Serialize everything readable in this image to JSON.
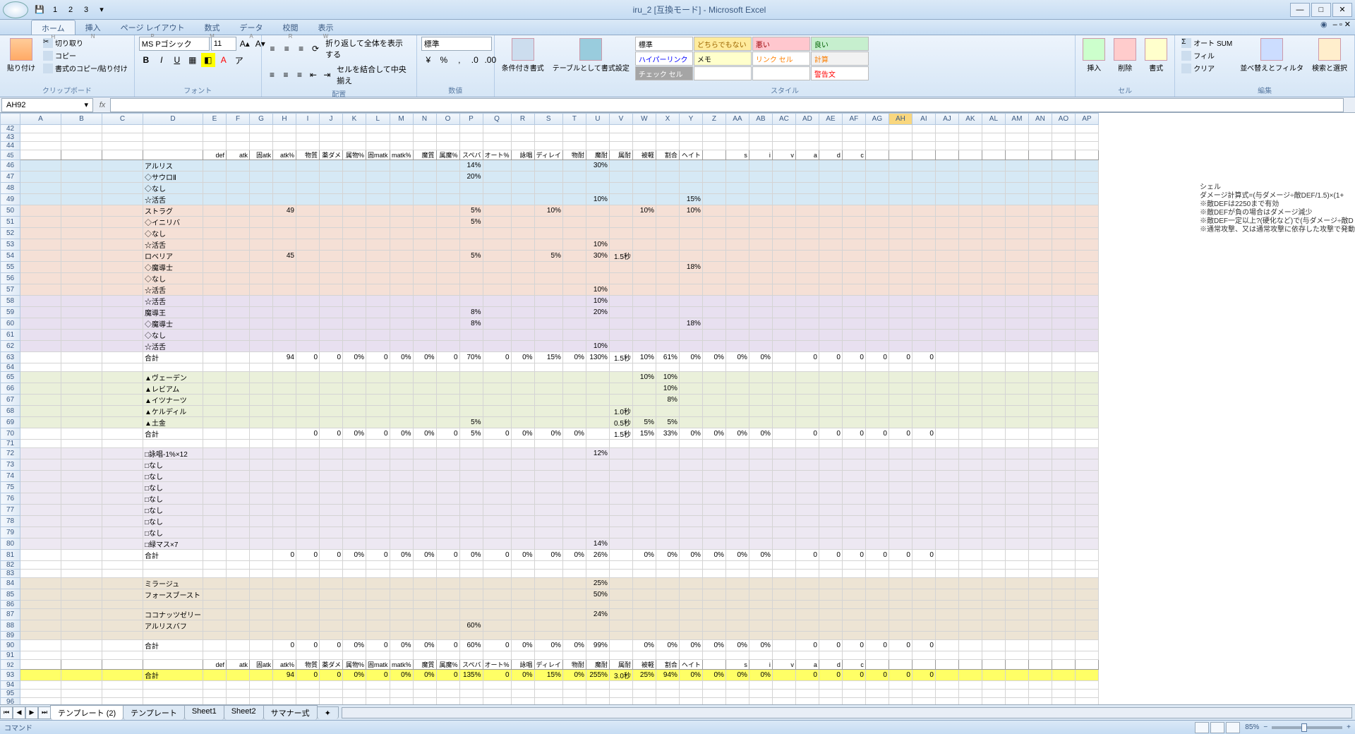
{
  "title": "iru_2 [互換モード] - Microsoft Excel",
  "tabs": [
    "ホーム",
    "挿入",
    "ページ レイアウト",
    "数式",
    "データ",
    "校閲",
    "表示"
  ],
  "tab_keys": [
    "H",
    "N",
    "P",
    "M",
    "A",
    "R",
    "W"
  ],
  "clipboard": {
    "paste": "貼り付け",
    "cut": "切り取り",
    "copy": "コピー",
    "fmt": "書式のコピー/貼り付け",
    "label": "クリップボード"
  },
  "font": {
    "name": "MS Pゴシック",
    "size": "11",
    "label": "フォント"
  },
  "align": {
    "wrap": "折り返して全体を表示する",
    "merge": "セルを結合して中央揃え",
    "label": "配置"
  },
  "number": {
    "fmt": "標準",
    "label": "数値"
  },
  "styles": {
    "cond": "条件付き書式",
    "tbl": "テーブルとして書式設定",
    "label": "スタイル",
    "cells": [
      {
        "t": "標準",
        "bg": "#fff",
        "c": "#000"
      },
      {
        "t": "どちらでもない",
        "bg": "#ffeb9c",
        "c": "#9c6500"
      },
      {
        "t": "悪い",
        "bg": "#ffc7ce",
        "c": "#9c0006"
      },
      {
        "t": "良い",
        "bg": "#c6efce",
        "c": "#006100"
      },
      {
        "t": "ハイパーリンク",
        "bg": "#fff",
        "c": "#0000ff"
      },
      {
        "t": "メモ",
        "bg": "#ffffcc",
        "c": "#000"
      },
      {
        "t": "リンク セル",
        "bg": "#fff",
        "c": "#ff8001"
      },
      {
        "t": "計算",
        "bg": "#f2f2f2",
        "c": "#fa7d00"
      },
      {
        "t": "チェック セル",
        "bg": "#a5a5a5",
        "c": "#fff"
      },
      {
        "t": "",
        "bg": "#fff",
        "c": "#000"
      },
      {
        "t": "",
        "bg": "#fff",
        "c": "#000"
      },
      {
        "t": "警告文",
        "bg": "#fff",
        "c": "#ff0000"
      }
    ]
  },
  "cells_grp": {
    "insert": "挿入",
    "delete": "削除",
    "format": "書式",
    "label": "セル"
  },
  "edit_grp": {
    "sum": "オート SUM",
    "fill": "フィル",
    "clear": "クリア",
    "sort": "並べ替えとフィルタ",
    "find": "検索と選択",
    "label": "編集"
  },
  "namebox": "AH92",
  "formula": "",
  "cols": [
    "A",
    "B",
    "C",
    "D",
    "E",
    "F",
    "G",
    "H",
    "I",
    "J",
    "K",
    "L",
    "M",
    "N",
    "O",
    "P",
    "Q",
    "R",
    "S",
    "T",
    "U",
    "V",
    "W",
    "X",
    "Y",
    "Z",
    "AA",
    "AB",
    "AC",
    "AD",
    "AE",
    "AF",
    "AG",
    "AH",
    "AI",
    "AJ",
    "AK",
    "AL",
    "AM",
    "AN",
    "AO",
    "AP"
  ],
  "active_col": "AH",
  "row_start": 42,
  "row_end": 96,
  "hdr": [
    "",
    "",
    "",
    "",
    "def",
    "atk",
    "固atk",
    "atk%",
    "物質",
    "薬ダメ",
    "属物%",
    "固matk",
    "matk%",
    "魔質",
    "属魔%",
    "スペバ",
    "オート%",
    "詠唱",
    "ディレイ",
    "物耐",
    "魔耐",
    "属耐",
    "被軽",
    "割合",
    "ヘイト",
    "",
    "s",
    "i",
    "v",
    "a",
    "d",
    "c"
  ],
  "rows": [
    {
      "n": 46,
      "cls": "blue-row",
      "d": [
        "アルリス",
        "",
        "",
        "",
        "",
        "",
        "",
        "",
        "",
        "",
        "",
        "",
        "14%",
        "",
        "",
        "",
        "",
        "30%"
      ]
    },
    {
      "n": 47,
      "cls": "blue-row",
      "d": [
        "◇サウロⅡ",
        "",
        "",
        "dark",
        "dark",
        "",
        "",
        "",
        "",
        "",
        "",
        "",
        "20%"
      ]
    },
    {
      "n": 48,
      "cls": "blue-row",
      "d": [
        "◇なし",
        "",
        "",
        "dark",
        "dark"
      ]
    },
    {
      "n": 49,
      "cls": "blue-row",
      "d": [
        "☆活舌",
        "",
        "",
        "dark",
        "dark",
        "",
        "",
        "",
        "",
        "",
        "",
        "",
        "",
        "",
        "",
        "",
        "",
        "10%",
        "",
        "",
        "",
        "15%"
      ]
    },
    {
      "n": 50,
      "cls": "pink-row",
      "d": [
        "ストラグ",
        "",
        "",
        "",
        "49",
        "",
        "",
        "",
        "",
        "",
        "",
        "",
        "5%",
        "",
        "",
        "10%",
        "",
        "",
        "",
        "10%",
        "",
        "10%"
      ]
    },
    {
      "n": 51,
      "cls": "pink-row",
      "d": [
        "◇イニリバ",
        "",
        "",
        "dark",
        "dark",
        "",
        "",
        "",
        "",
        "",
        "",
        "",
        "5%"
      ]
    },
    {
      "n": 52,
      "cls": "pink-row",
      "d": [
        "◇なし",
        "",
        "",
        "dark",
        "dark"
      ]
    },
    {
      "n": 53,
      "cls": "pink-row",
      "d": [
        "☆活舌",
        "",
        "",
        "dark",
        "dark",
        "",
        "",
        "",
        "",
        "",
        "",
        "",
        "",
        "",
        "",
        "",
        "",
        "10%"
      ]
    },
    {
      "n": 54,
      "cls": "pink-row",
      "d": [
        "ロベリア",
        "",
        "",
        "",
        "45",
        "",
        "",
        "",
        "",
        "",
        "",
        "",
        "5%",
        "",
        "",
        "5%",
        "",
        "30%",
        "1.5秒"
      ]
    },
    {
      "n": 55,
      "cls": "pink-row",
      "d": [
        "◇魔導士",
        "",
        "",
        "dark",
        "dark",
        "",
        "",
        "",
        "",
        "",
        "",
        "",
        "",
        "",
        "",
        "",
        "",
        "",
        "",
        "",
        "",
        "18%"
      ]
    },
    {
      "n": 56,
      "cls": "pink-row",
      "d": [
        "◇なし",
        "",
        "",
        "dark",
        "dark"
      ]
    },
    {
      "n": 57,
      "cls": "pink-row",
      "d": [
        "☆活舌",
        "",
        "",
        "dark",
        "dark",
        "",
        "",
        "",
        "",
        "",
        "",
        "",
        "",
        "",
        "",
        "",
        "",
        "10%"
      ]
    },
    {
      "n": 58,
      "cls": "purp-row",
      "d": [
        "☆活舌",
        "",
        "",
        "dark",
        "dark",
        "",
        "",
        "",
        "",
        "",
        "",
        "",
        "",
        "",
        "",
        "",
        "",
        "10%"
      ]
    },
    {
      "n": 59,
      "cls": "purp-row",
      "d": [
        "魔導王",
        "",
        "",
        "",
        "",
        "",
        "",
        "",
        "",
        "",
        "",
        "",
        "8%",
        "",
        "",
        "",
        "",
        "20%"
      ]
    },
    {
      "n": 60,
      "cls": "purp-row",
      "d": [
        "◇魔導士",
        "",
        "",
        "dark",
        "dark",
        "",
        "",
        "",
        "",
        "",
        "",
        "",
        "8%",
        "",
        "",
        "",
        "",
        "",
        "",
        "",
        "",
        "18%"
      ]
    },
    {
      "n": 61,
      "cls": "purp-row",
      "d": [
        "◇なし",
        "",
        "",
        "dark",
        "dark"
      ]
    },
    {
      "n": 62,
      "cls": "purp-row",
      "d": [
        "☆活舌",
        "",
        "",
        "dark",
        "dark",
        "",
        "",
        "",
        "",
        "",
        "",
        "",
        "",
        "",
        "",
        "",
        "",
        "10%"
      ]
    },
    {
      "n": 63,
      "cls": "",
      "d": [
        "合計",
        "",
        "",
        "",
        "94",
        "0",
        "0",
        "0%",
        "0",
        "0%",
        "0%",
        "0",
        "70%",
        "0",
        "0%",
        "15%",
        "0%",
        "130%",
        "1.5秒",
        "10%",
        "61%",
        "0%",
        "0%",
        "0%",
        "0%",
        "",
        "0",
        "0",
        "0",
        "0",
        "0",
        "0"
      ]
    },
    {
      "n": 64,
      "cls": "",
      "d": []
    },
    {
      "n": 65,
      "cls": "green-row",
      "d": [
        "▲ヴェーデン",
        "",
        "",
        "",
        "",
        "",
        "",
        "",
        "",
        "",
        "",
        "",
        "",
        "",
        "",
        "",
        "",
        "",
        "",
        "10%",
        "10%"
      ]
    },
    {
      "n": 66,
      "cls": "green-row",
      "d": [
        "▲レビアム",
        "",
        "",
        "",
        "",
        "",
        "",
        "",
        "",
        "",
        "",
        "",
        "",
        "",
        "",
        "",
        "",
        "",
        "",
        "",
        "10%"
      ]
    },
    {
      "n": 67,
      "cls": "green-row",
      "d": [
        "▲イツナーツ",
        "",
        "",
        "",
        "",
        "",
        "",
        "",
        "",
        "",
        "",
        "",
        "",
        "",
        "",
        "",
        "",
        "",
        "",
        "",
        "8%"
      ]
    },
    {
      "n": 68,
      "cls": "green-row",
      "d": [
        "▲ケルディル",
        "",
        "",
        "",
        "",
        "",
        "",
        "",
        "",
        "",
        "",
        "",
        "",
        "",
        "",
        "",
        "",
        "",
        "1.0秒"
      ]
    },
    {
      "n": 69,
      "cls": "green-row",
      "d": [
        "▲土金",
        "",
        "",
        "",
        "",
        "",
        "",
        "",
        "",
        "",
        "",
        "",
        "5%",
        "",
        "",
        "",
        "",
        "",
        "0.5秒",
        "5%",
        "5%"
      ]
    },
    {
      "n": 70,
      "cls": "",
      "d": [
        "合計",
        "",
        "",
        "",
        "",
        "0",
        "0",
        "0%",
        "0",
        "0%",
        "0%",
        "0",
        "5%",
        "0",
        "0%",
        "0%",
        "0%",
        "",
        "1.5秒",
        "15%",
        "33%",
        "0%",
        "0%",
        "0%",
        "0%",
        "",
        "0",
        "0",
        "0",
        "0",
        "0",
        "0"
      ]
    },
    {
      "n": 71,
      "cls": "",
      "d": []
    },
    {
      "n": 72,
      "cls": "ltpurp-row",
      "d": [
        "□詠唱-1%×12",
        "",
        "",
        "",
        "",
        "",
        "",
        "",
        "",
        "",
        "",
        "",
        "",
        "",
        "",
        "",
        "",
        "12%"
      ]
    },
    {
      "n": 73,
      "cls": "ltpurp-row",
      "d": [
        "□なし"
      ]
    },
    {
      "n": 74,
      "cls": "ltpurp-row",
      "d": [
        "□なし"
      ]
    },
    {
      "n": 75,
      "cls": "ltpurp-row",
      "d": [
        "□なし"
      ]
    },
    {
      "n": 76,
      "cls": "ltpurp-row",
      "d": [
        "□なし"
      ]
    },
    {
      "n": 77,
      "cls": "ltpurp-row",
      "d": [
        "□なし"
      ]
    },
    {
      "n": 78,
      "cls": "ltpurp-row",
      "d": [
        "□なし"
      ]
    },
    {
      "n": 79,
      "cls": "ltpurp-row",
      "d": [
        "□なし"
      ]
    },
    {
      "n": 80,
      "cls": "ltpurp-row",
      "d": [
        "□緑マス×7",
        "",
        "",
        "",
        "",
        "",
        "",
        "",
        "",
        "",
        "",
        "",
        "",
        "",
        "",
        "",
        "",
        "14%"
      ]
    },
    {
      "n": 81,
      "cls": "",
      "d": [
        "合計",
        "",
        "",
        "",
        "0",
        "0",
        "0",
        "0%",
        "0",
        "0%",
        "0%",
        "0",
        "0%",
        "0",
        "0%",
        "0%",
        "0%",
        "26%",
        "",
        "0%",
        "0%",
        "0%",
        "0%",
        "0%",
        "0%",
        "",
        "0",
        "0",
        "0",
        "0",
        "0",
        "0"
      ]
    },
    {
      "n": 82,
      "cls": "",
      "d": []
    },
    {
      "n": 83,
      "cls": "",
      "d": []
    },
    {
      "n": 84,
      "cls": "tan-row",
      "d": [
        "ミラージュ",
        "",
        "",
        "",
        "",
        "",
        "",
        "",
        "",
        "",
        "",
        "",
        "",
        "",
        "",
        "",
        "",
        "25%"
      ]
    },
    {
      "n": 85,
      "cls": "tan-row",
      "d": [
        "フォースブースト",
        "",
        "",
        "",
        "",
        "",
        "",
        "",
        "",
        "",
        "",
        "",
        "",
        "",
        "",
        "",
        "",
        "50%"
      ]
    },
    {
      "n": 86,
      "cls": "tan-row",
      "d": []
    },
    {
      "n": 87,
      "cls": "tan-row",
      "d": [
        "ココナッツゼリー",
        "",
        "",
        "",
        "",
        "",
        "",
        "",
        "",
        "",
        "",
        "",
        "",
        "",
        "",
        "",
        "",
        "24%"
      ]
    },
    {
      "n": 88,
      "cls": "tan-row",
      "d": [
        "アルリスバフ",
        "",
        "",
        "",
        "",
        "",
        "",
        "",
        "",
        "",
        "",
        "",
        "60%"
      ]
    },
    {
      "n": 89,
      "cls": "tan-row",
      "d": []
    },
    {
      "n": 90,
      "cls": "",
      "d": [
        "合計",
        "",
        "",
        "",
        "0",
        "0",
        "0",
        "0%",
        "0",
        "0%",
        "0%",
        "0",
        "60%",
        "0",
        "0%",
        "0%",
        "0%",
        "99%",
        "",
        "0%",
        "0%",
        "0%",
        "0%",
        "0%",
        "0%",
        "",
        "0",
        "0",
        "0",
        "0",
        "0",
        "0"
      ]
    },
    {
      "n": 91,
      "cls": "",
      "d": []
    },
    {
      "n": 93,
      "cls": "yellow-row",
      "d": [
        "合計",
        "",
        "",
        "",
        "94",
        "0",
        "0",
        "0%",
        "0",
        "0%",
        "0%",
        "0",
        "135%",
        "0",
        "0%",
        "15%",
        "0%",
        "255%",
        "3.0秒",
        "25%",
        "94%",
        "0%",
        "0%",
        "0%",
        "0%",
        "",
        "0",
        "0",
        "0",
        "0",
        "0",
        "0"
      ],
      "mag": [
        12,
        17,
        18,
        19,
        20
      ]
    },
    {
      "n": 94,
      "cls": "",
      "d": []
    },
    {
      "n": 95,
      "cls": "",
      "d": []
    },
    {
      "n": 96,
      "cls": "",
      "d": []
    }
  ],
  "hdr2_row": 92,
  "notes_title": "シェル",
  "notes": [
    "ダメージ計算式=(与ダメージ÷敵DEF/1.5)×(1+",
    "※敵DEFは2250まで有効",
    "※敵DEFが負の場合はダメージ減少",
    "※敵DEF一定以上?(硬化など)で(与ダメージ÷敵D",
    "※通常攻撃、又は通常攻撃に依存した攻撃で発動"
  ],
  "sheet_tabs": [
    "テンプレート (2)",
    "テンプレート",
    "Sheet1",
    "Sheet2",
    "サマナー式"
  ],
  "active_sheet": 0,
  "status": "コマンド",
  "zoom": "85%"
}
